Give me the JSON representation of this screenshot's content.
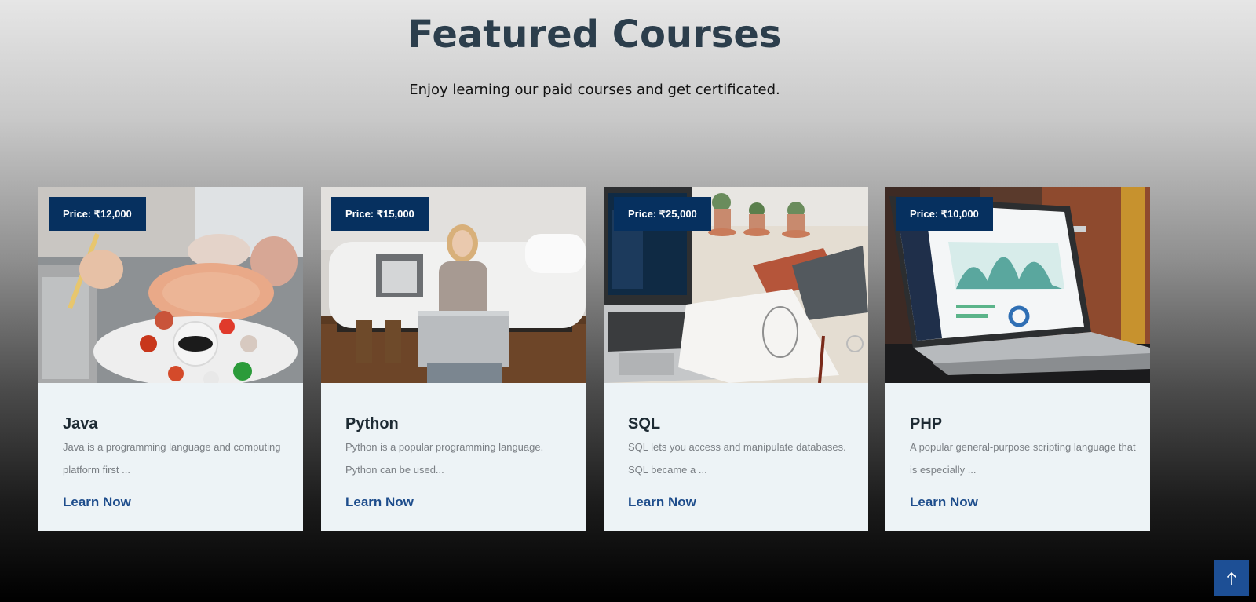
{
  "section": {
    "title": "Featured Courses",
    "subtitle": "Enjoy learning our paid courses and get certificated."
  },
  "courses": [
    {
      "price": "Price: ₹12,000",
      "title": "Java",
      "description": "Java is a programming language and computing platform first ...",
      "link_label": "Learn Now"
    },
    {
      "price": "Price: ₹15,000",
      "title": "Python",
      "description": "Python is a popular programming language. Python can be used...",
      "link_label": "Learn Now"
    },
    {
      "price": "Price: ₹25,000",
      "title": "SQL",
      "description": "SQL lets you access and manipulate databases. SQL became a ...",
      "link_label": "Learn Now"
    },
    {
      "price": "Price: ₹10,000",
      "title": "PHP",
      "description": "A popular general-purpose scripting language that is especially ...",
      "link_label": "Learn Now"
    }
  ],
  "scroll_top": {
    "icon": "arrow-up-icon"
  },
  "colors": {
    "price_badge": "#06305f",
    "link": "#1e4d8c",
    "card_bg": "#edf3f6",
    "scroll_button": "#1d4f95",
    "title": "#2c3e4c"
  }
}
